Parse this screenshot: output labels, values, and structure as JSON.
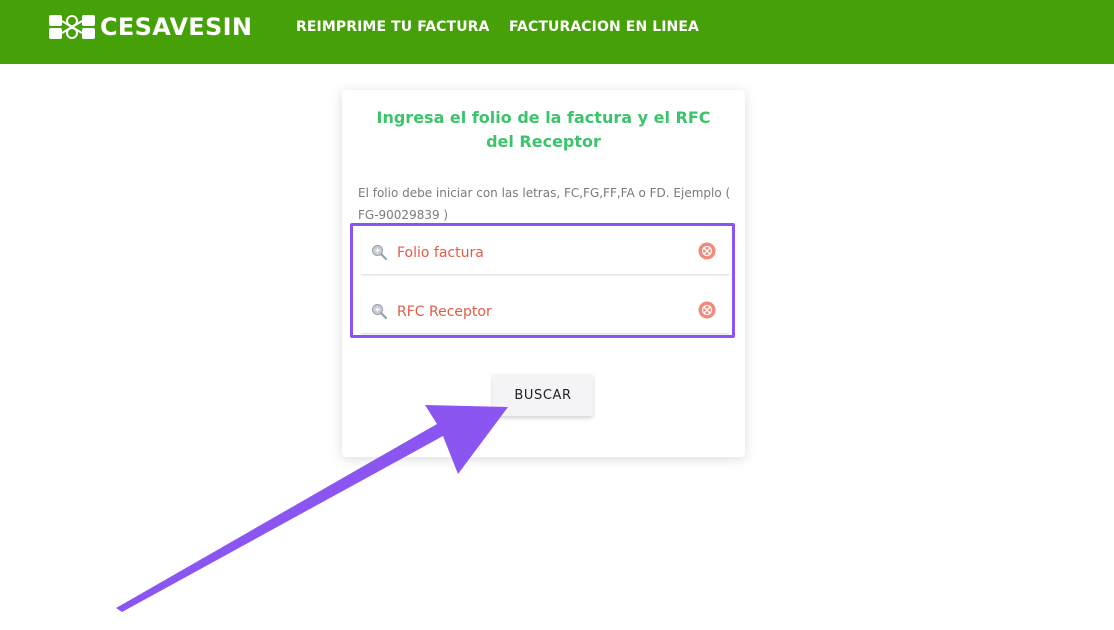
{
  "header": {
    "brand": "CESAVESIN",
    "nav": [
      {
        "label": "REIMPRIME TU FACTURA"
      },
      {
        "label": "FACTURACION EN LINEA"
      }
    ],
    "background_color": "#46a008"
  },
  "card": {
    "title": "Ingresa el folio de la factura y el RFC del Receptor",
    "hint": "El folio debe iniciar con las letras, FC,FG,FF,FA o FD. Ejemplo ( FG-90029839 )",
    "fields": [
      {
        "placeholder": "Folio factura",
        "value": "",
        "icon": "search-icon",
        "action_icon": "clear-icon"
      },
      {
        "placeholder": "RFC Receptor",
        "value": "",
        "icon": "search-icon",
        "action_icon": "clear-icon"
      }
    ],
    "button_label": "BUSCAR",
    "title_color": "#3cc46c",
    "placeholder_color": "#e25b45"
  },
  "annotation": {
    "highlight_color": "#8a55f0",
    "arrow_color": "#8a55f0"
  }
}
